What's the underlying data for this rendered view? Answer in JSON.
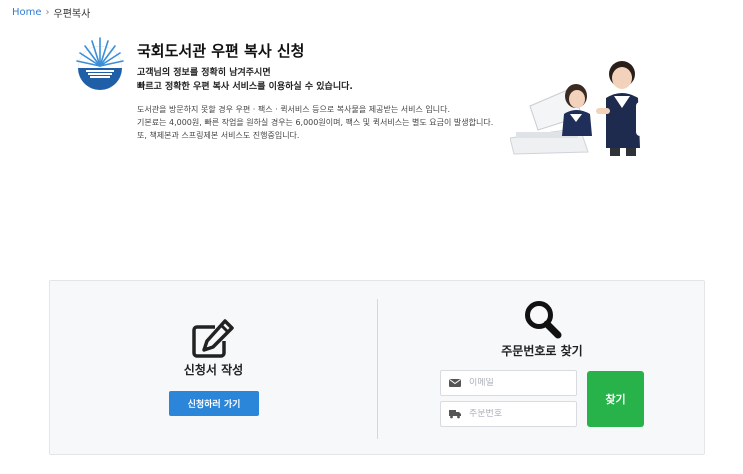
{
  "breadcrumb": {
    "home": "Home",
    "separator": "›",
    "current": "우편복사"
  },
  "hero": {
    "title": "국회도서관 우편 복사 신청",
    "subtitle_line1": "고객님의 정보를 정확히 남겨주시면",
    "subtitle_line2": "빠르고 정확한 우편 복사 서비스를 이용하실 수 있습니다.",
    "desc_line1": "도서관을 방문하지 못할 경우 우편 · 팩스 · 퀵서비스 등으로 복사물을 제공받는 서비스 입니다.",
    "desc_line2": "기본료는 4,000원, 빠른 작업을 원하실 경우는 6,000원이며, 팩스 및 퀵서비스는 별도 요금이 발생합니다.",
    "desc_line3": "또, 책제본과 스프링제본 서비스도 진행중입니다."
  },
  "apply": {
    "icon": "edit-icon",
    "title": "신청서 작성",
    "button": "신청하러 가기"
  },
  "lookup": {
    "icon": "search-icon",
    "title": "주문번호로 찾기",
    "email_placeholder": "이메일",
    "email_icon": "envelope-icon",
    "order_placeholder": "주문번호",
    "order_icon": "truck-icon",
    "button": "찾기"
  },
  "colors": {
    "link": "#2f7ed8",
    "apply_button": "#2b86d9",
    "find_button": "#28b34a",
    "panel_bg": "#f7f8fa"
  }
}
